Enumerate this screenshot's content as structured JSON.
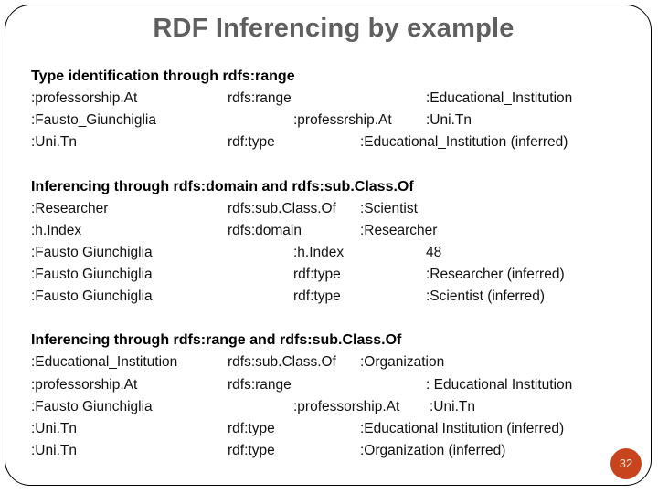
{
  "slide": {
    "title": "RDF Inferencing by example",
    "page_number": "32",
    "accent_color": "#c8441c",
    "sections": [
      {
        "heading": "Type identification through rdfs:range",
        "rows": [
          [
            ":professorship.At",
            "rdfs:range",
            ":Educational_Institution"
          ],
          [
            ":Fausto_Giunchiglia",
            ":professrship.At",
            ":Uni.Tn"
          ],
          [
            ":Uni.Tn",
            "rdf:type",
            ":Educational_Institution (inferred)"
          ]
        ]
      },
      {
        "heading": "Inferencing through rdfs:domain and rdfs:sub.Class.Of",
        "rows": [
          [
            ":Researcher",
            "rdfs:sub.Class.Of",
            ":Scientist"
          ],
          [
            ":h.Index",
            "rdfs:domain",
            ":Researcher"
          ],
          [
            ":Fausto Giunchiglia",
            ":h.Index",
            "48"
          ],
          [
            ":Fausto Giunchiglia",
            "rdf:type",
            ":Researcher (inferred)"
          ],
          [
            ":Fausto Giunchiglia",
            "rdf:type",
            ":Scientist (inferred)"
          ]
        ]
      },
      {
        "heading": "Inferencing through rdfs:range and rdfs:sub.Class.Of",
        "rows": [
          [
            ":Educational_Institution",
            "rdfs:sub.Class.Of",
            ":Organization"
          ],
          [
            ":professorship.At",
            "rdfs:range",
            ": Educational Institution"
          ],
          [
            ":Fausto Giunchiglia",
            ":professorship.At",
            ":Uni.Tn"
          ],
          [
            ":Uni.Tn",
            "rdf:type",
            ":Educational Institution (inferred)"
          ],
          [
            ":Uni.Tn",
            "rdf:type",
            ":Organization (inferred)"
          ]
        ]
      }
    ]
  }
}
